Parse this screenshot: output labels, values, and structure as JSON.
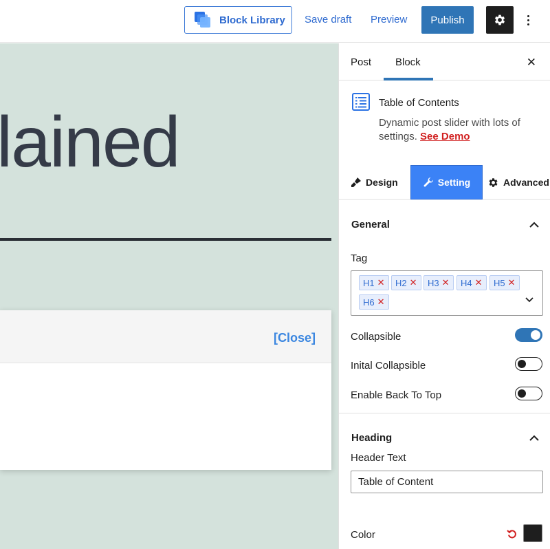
{
  "toolbar": {
    "block_library_label": "Block Library",
    "save_draft_label": "Save draft",
    "preview_label": "Preview",
    "publish_label": "Publish"
  },
  "canvas": {
    "title_fragment": "lained",
    "toc_close_label": "[Close]"
  },
  "sidebar": {
    "tabs": [
      {
        "label": "Post"
      },
      {
        "label": "Block"
      }
    ],
    "block": {
      "name": "Table of Contents",
      "description": "Dynamic post slider with lots of settings.",
      "demo_link": "See Demo"
    },
    "mode_tabs": [
      {
        "label": "Design"
      },
      {
        "label": "Setting"
      },
      {
        "label": "Advanced"
      }
    ],
    "general": {
      "title": "General",
      "tag_label": "Tag",
      "tags": [
        "H1",
        "H2",
        "H3",
        "H4",
        "H5",
        "H6"
      ],
      "collapsible_label": "Collapsible",
      "collapsible_on": true,
      "initial_collapsible_label": "Inital Collapsible",
      "initial_collapsible_on": false,
      "back_to_top_label": "Enable Back To Top",
      "back_to_top_on": false
    },
    "heading": {
      "title": "Heading",
      "header_text_label": "Header Text",
      "header_text_value": "Table of Content",
      "color_label": "Color",
      "color_value": "#1e1e1e"
    }
  },
  "colors": {
    "accent": "#2f75b6",
    "active_tab": "#3b82f6",
    "canvas_bg": "#d4e2dc",
    "demo_link": "#d12020"
  }
}
